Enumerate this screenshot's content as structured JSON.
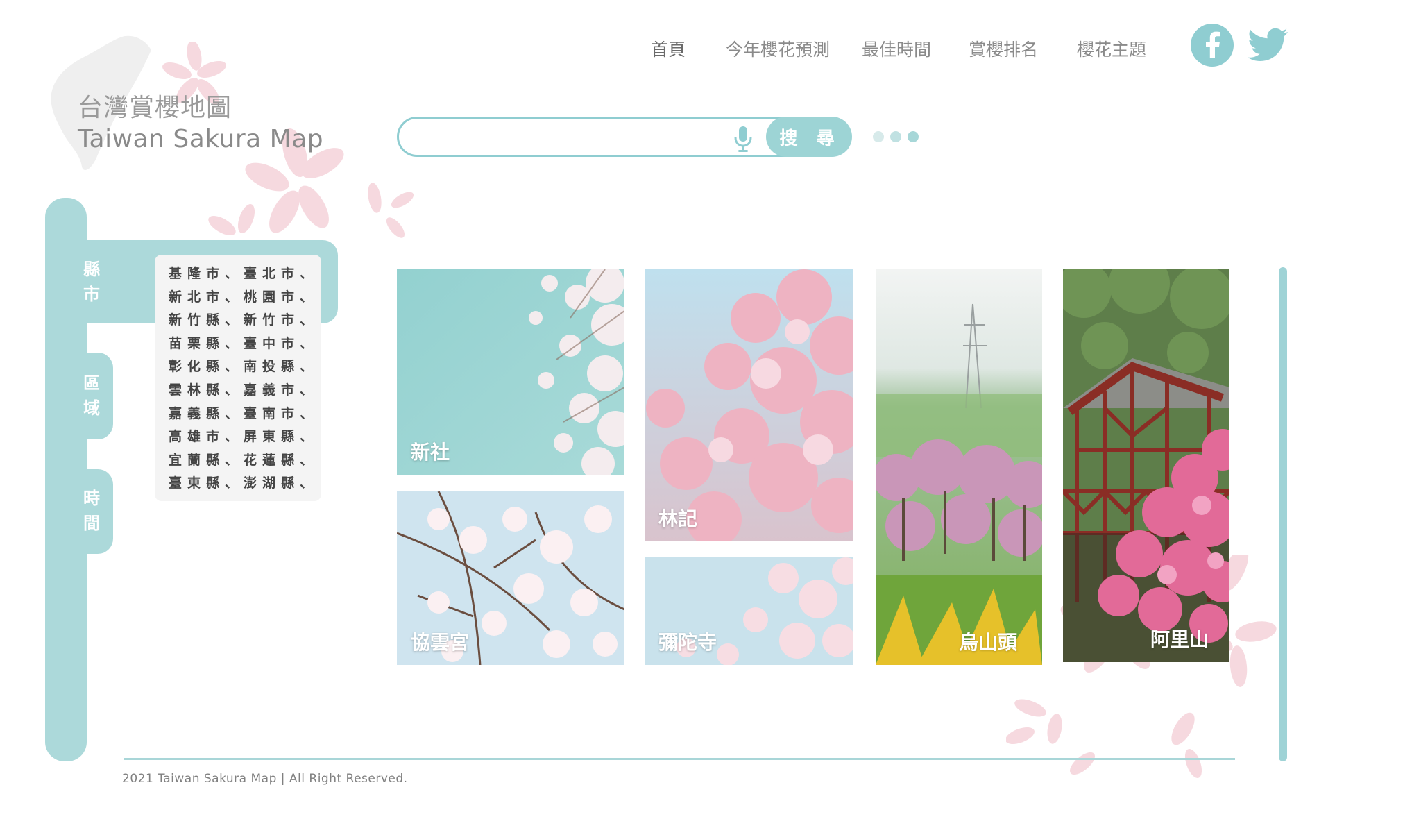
{
  "logo": {
    "title_zh": "台灣賞櫻地圖",
    "title_en": "Taiwan Sakura Map"
  },
  "nav": {
    "items": [
      {
        "label": "首頁",
        "active": true
      },
      {
        "label": "今年櫻花預測",
        "active": false
      },
      {
        "label": "最佳時間",
        "active": false
      },
      {
        "label": "賞櫻排名",
        "active": false
      },
      {
        "label": "櫻花主題",
        "active": false
      }
    ]
  },
  "social": {
    "icons": [
      "facebook-icon",
      "twitter-icon"
    ],
    "color": "#8fcdd1"
  },
  "search": {
    "value": "",
    "placeholder": "",
    "button_label": "搜 尋",
    "icon": "microphone-icon"
  },
  "carousel": {
    "dot_count": 3,
    "active_index": 2,
    "dot_color": "#d3e9ea",
    "active_color": "#a7d7d8"
  },
  "sidebar": {
    "tabs": [
      {
        "label": "縣市",
        "active": true
      },
      {
        "label": "區域",
        "active": false
      },
      {
        "label": "時間",
        "active": false
      }
    ],
    "counties": [
      "基隆市、臺北市、",
      "新北市、桃園市、",
      "新竹縣、新竹市、",
      "苗栗縣、臺中市、",
      "彰化縣、南投縣、",
      "雲林縣、嘉義市、",
      "嘉義縣、臺南市、",
      "高雄市、屏東縣、",
      "宜蘭縣、花蓮縣、",
      "臺東縣、澎湖縣、"
    ]
  },
  "gallery": {
    "items": [
      {
        "label": "新社"
      },
      {
        "label": "協雲宮"
      },
      {
        "label": "林記"
      },
      {
        "label": "彌陀寺"
      },
      {
        "label": "烏山頭"
      },
      {
        "label": "阿里山"
      }
    ]
  },
  "colors": {
    "accent": "#acd9da",
    "petal": "#f6d9df"
  },
  "footer": {
    "copyright": "2021 Taiwan Sakura Map | All Right Reserved."
  }
}
